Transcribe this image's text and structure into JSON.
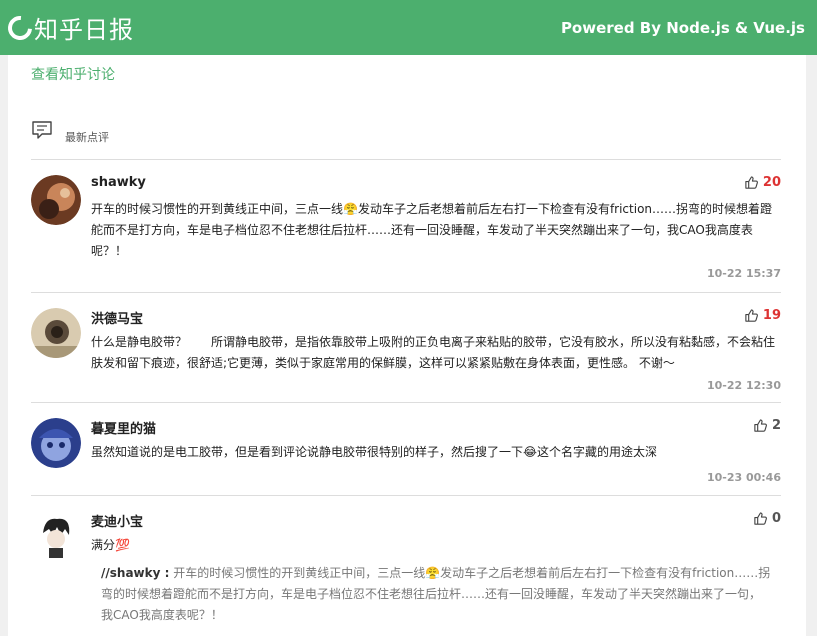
{
  "header": {
    "logo_text": "知乎日报",
    "powered_by": "Powered By Node.js & Vue.js"
  },
  "page": {
    "discuss_link": "查看知乎讨论",
    "section_title": "最新点评"
  },
  "comments": [
    {
      "author": "shawky",
      "likes": "20",
      "content": "开车的时候习惯性的开到黄线正中间，三点一线😤发动车子之后老想着前后左右打一下检查有没有friction……拐弯的时候想着蹬舵而不是打方向，车是电子档位忍不住老想往后拉杆……还有一回没睡醒，车发动了半天突然蹦出来了一句，我CAO我高度表呢？！",
      "time": "10-22 15:37"
    },
    {
      "author": "洪德马宝",
      "likes": "19",
      "content": "什么是静电胶带？　　所谓静电胶带，是指依靠胶带上吸附的正负电离子来粘贴的胶带，它没有胶水，所以没有粘黏感，不会粘住肤发和留下痕迹，很舒适;它更薄，类似于家庭常用的保鲜膜，这样可以紧紧贴敷在身体表面，更性感。 不谢～",
      "time": "10-22 12:30"
    },
    {
      "author": "暮夏里的猫",
      "likes": "2",
      "content": "虽然知道说的是电工胶带，但是看到评论说静电胶带很特别的样子，然后搜了一下😂这个名字藏的用途太深",
      "time": "10-23 00:46"
    },
    {
      "author": "麦迪小宝",
      "likes": "0",
      "content": "满分💯",
      "quote_author": "//shawky :",
      "quote_text": " 开车的时候习惯性的开到黄线正中间，三点一线😤发动车子之后老想着前后左右打一下检查有没有friction……拐弯的时候想着蹬舵而不是打方向，车是电子档位忍不住老想往后拉杆……还有一回没睡醒，车发动了半天突然蹦出来了一句，我CAO我高度表呢？！"
    }
  ],
  "colors": {
    "brand": "#4caf6e",
    "hot_likes": "#dd3333"
  }
}
